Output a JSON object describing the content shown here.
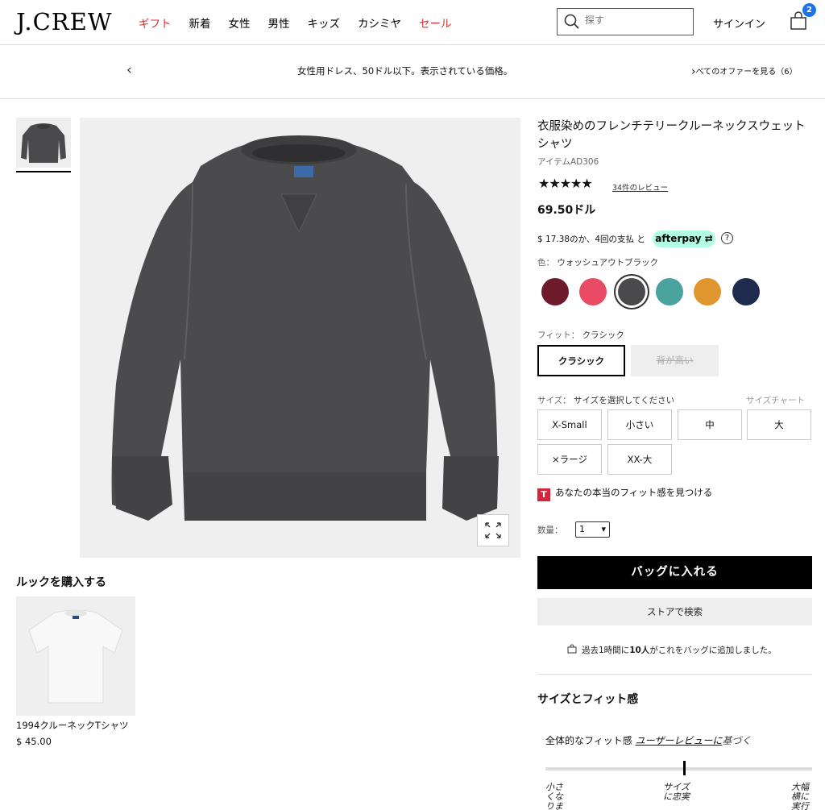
{
  "header": {
    "logo": "J.CREW",
    "nav": [
      {
        "label": "ギフト",
        "highlight": true
      },
      {
        "label": "新着",
        "highlight": false
      },
      {
        "label": "女性",
        "highlight": false
      },
      {
        "label": "男性",
        "highlight": false
      },
      {
        "label": "キッズ",
        "highlight": false
      },
      {
        "label": "カシミヤ",
        "highlight": false
      },
      {
        "label": "セール",
        "highlight": true
      }
    ],
    "search_placeholder": "探す",
    "signin": "サインイン",
    "bag_count": "2"
  },
  "promo": {
    "prev": "‹",
    "text": "女性用ドレス、50ドル以下。表示されている価格。",
    "next_arrow": "›",
    "next_label": "べてのオファーを見る（6）"
  },
  "product": {
    "title": "衣服染めのフレンチテリークルーネックスウェットシャツ",
    "item_code": "アイテムAD306",
    "stars": "★★★★★",
    "rating": 4.5,
    "reviews": "34件のレビュー",
    "price": "69.50ドル",
    "afterpay_text": "$ 17.38のか、4回の支払 と",
    "afterpay_brand": "afterpay",
    "info": "?",
    "color_key": "色：",
    "color_value": "ウォッシュアウトブラック",
    "swatches": [
      {
        "name": "burgundy",
        "color": "#6e1a2a"
      },
      {
        "name": "coral",
        "color": "#e84b63"
      },
      {
        "name": "washed-black",
        "color": "#4a4a4c"
      },
      {
        "name": "teal",
        "color": "#4aa39f"
      },
      {
        "name": "mustard",
        "color": "#e0962f"
      },
      {
        "name": "navy",
        "color": "#1e2b4f"
      }
    ],
    "selected_swatch": 2,
    "fit_key": "フィット：",
    "fit_value": "クラシック",
    "fit_options": [
      "クラシック",
      "背が高い"
    ],
    "size_key": "サイズ：",
    "size_value": "サイズを選択してください",
    "size_chart": "サイズチャート",
    "sizes": [
      "X-Small",
      "小さい",
      "中",
      "大",
      "×ラージ",
      "XX-大"
    ],
    "fit_finder_icon": "T",
    "fit_finder": "あなたの本当のフィット感を見つける",
    "qty_label": "数量：",
    "qty_value": "1",
    "add_to_bag": "バッグに入れる",
    "find_in_store": "ストアで検索",
    "social_proof_pre": "過去1時間に",
    "social_proof_count": "10人",
    "social_proof_post": "がこれをバッグに追加しました。"
  },
  "fit_section": {
    "heading": "サイズとフィット感",
    "overall_label": "全体的なフィット感",
    "overall_link": "ユーザーレビューに",
    "overall_tail": "基づく",
    "scale_left": "小さ\nくな\nりま",
    "scale_mid": "サイズ\nに忠実",
    "scale_right": "大幅\n横に\n実行",
    "marker_position": 0.5
  },
  "look": {
    "title": "ルックを購入する",
    "item_name": "1994クルーネックTシャツ",
    "item_price": "$ 45.00"
  },
  "colors": {
    "accent_red": "#d0312d",
    "badge_blue": "#1a73e8",
    "afterpay_mint": "#b2fce4"
  }
}
